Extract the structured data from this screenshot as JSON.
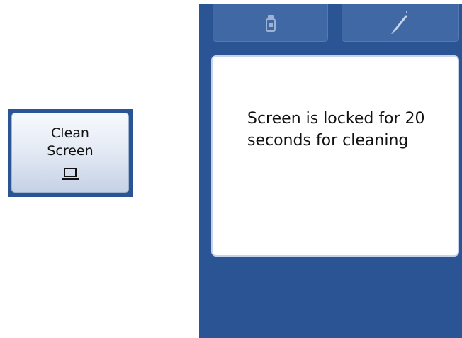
{
  "clean_screen_button": {
    "label": "Clean\nScreen",
    "icon": "laptop-icon"
  },
  "device_panel": {
    "toolbar": {
      "left_icon": "bottle-icon",
      "right_icon": "pen-icon"
    },
    "lock_dialog": {
      "message": "Screen is locked for 20 seconds for cleaning"
    }
  },
  "colors": {
    "panel_blue": "#2a5494",
    "tool_button_blue": "#3f68a4",
    "dialog_background": "#ffffff"
  }
}
